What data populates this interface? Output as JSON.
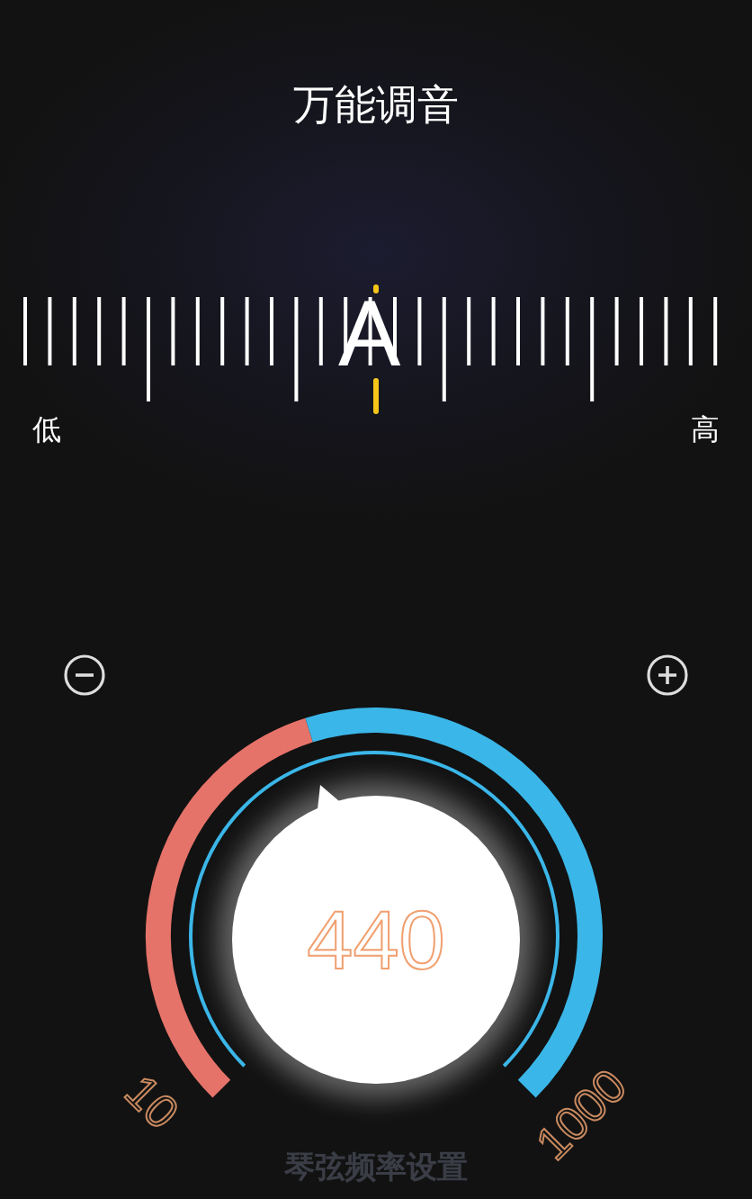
{
  "title": "万能调音",
  "ruler": {
    "note": "A",
    "low": "低",
    "high": "高"
  },
  "dial": {
    "min": "10",
    "max": "1000",
    "value": "440",
    "label": "琴弦频率设置"
  }
}
